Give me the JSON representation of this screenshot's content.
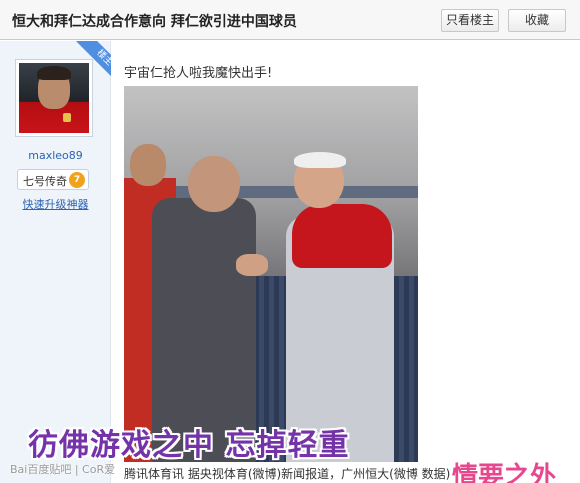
{
  "header": {
    "title": "恒大和拜仁达成合作意向 拜仁欲引进中国球员",
    "only_op_button": "只看楼主",
    "favorite_button": "收藏"
  },
  "author": {
    "username": "maxleo89",
    "level_name": "七号传奇",
    "level_number": "7",
    "upgrade_link": "快速升级神器",
    "badge": "楼主"
  },
  "post": {
    "text": "宇宙仁抢人啦我魔快出手!",
    "image_caption": "彷佛游戏之中 忘掉轻重",
    "watermark": "Bai百度贴吧 | CoR爱",
    "body_line": "腾讯体育讯 据央视体育(微博)新闻报道，广州恒大(微博 数据)",
    "corner_caption": "情要之外"
  },
  "colors": {
    "link": "#2d64b3",
    "badge": "#4f8ee0",
    "caption": "#7433a8"
  }
}
